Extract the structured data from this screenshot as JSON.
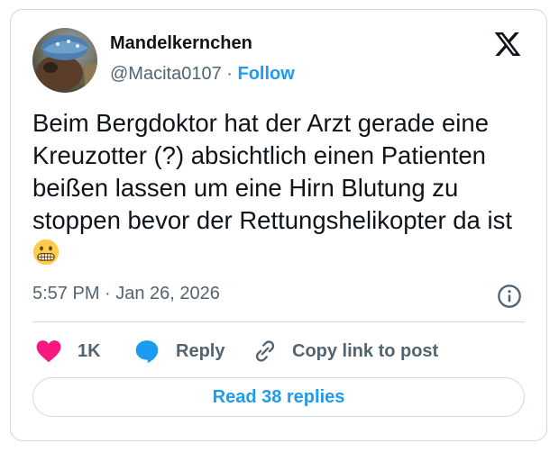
{
  "author": {
    "display_name": "Mandelkernchen",
    "handle": "@Macita0107",
    "separator": " · ",
    "follow_label": "Follow"
  },
  "platform_icon": "x-logo-icon",
  "tweet": {
    "text": "Beim Bergdoktor hat der Arzt gerade eine Kreuzotter (?) absichtlich einen Patienten beißen lassen um eine Hirn Blutung zu stoppen bevor der Rettungshelikopter da ist",
    "emoji": "grimacing-face-emoji",
    "timestamp": "5:57 PM · Jan 26, 2026"
  },
  "actions": {
    "like_count": "1K",
    "reply_label": "Reply",
    "copy_label": "Copy link to post"
  },
  "read_replies_label": "Read 38 replies",
  "colors": {
    "accent": "#1d9bf0",
    "like": "#f91880",
    "secondary_text": "#536471",
    "border": "#cfd9de"
  }
}
